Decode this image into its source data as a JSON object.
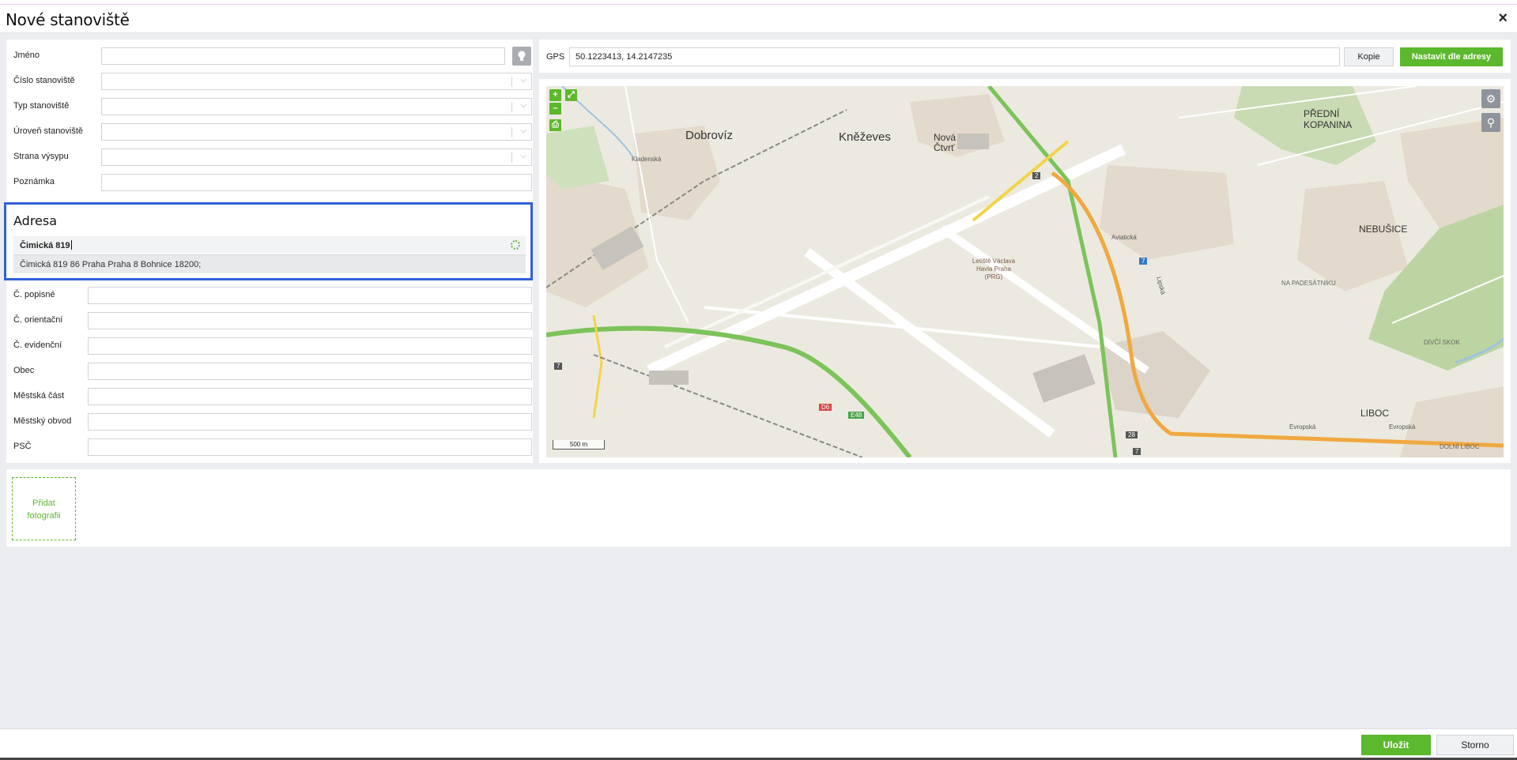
{
  "window": {
    "title": "Nové stanoviště",
    "close_icon": "×"
  },
  "form": {
    "jmeno": {
      "label": "Jméno",
      "value": ""
    },
    "cislo": {
      "label": "Číslo stanoviště",
      "value": ""
    },
    "typ": {
      "label": "Typ stanoviště",
      "value": ""
    },
    "uroven": {
      "label": "Úroveň stanoviště",
      "value": ""
    },
    "strana": {
      "label": "Strana výsypu",
      "value": ""
    },
    "poznamka": {
      "label": "Poznámka",
      "value": ""
    }
  },
  "address": {
    "heading": "Adresa",
    "search_value": "Čimická 819",
    "suggestion": "Čimická 819 86 Praha Praha 8 Bohnice 18200;",
    "fields": [
      {
        "label": "Č. popisné",
        "value": ""
      },
      {
        "label": "Č. orientační",
        "value": ""
      },
      {
        "label": "Č. evidenční",
        "value": ""
      },
      {
        "label": "Obec",
        "value": ""
      },
      {
        "label": "Městská část",
        "value": ""
      },
      {
        "label": "Městský obvod",
        "value": ""
      },
      {
        "label": "PSČ",
        "value": ""
      }
    ]
  },
  "gps": {
    "label": "GPS",
    "value": "50.1223413, 14.2147235",
    "copy_button": "Kopie",
    "set_button": "Nastavit dle adresy"
  },
  "map": {
    "zoom_in": "+",
    "zoom_out": "–",
    "labels": {
      "dobroviz": "Dobrovíz",
      "knezeves": "Kněževes",
      "nova_ctvrt": "Nová Čtvrť",
      "predni_kopanina": "PŘEDNÍ KOPANINA",
      "nebusice": "NEBUŠICE",
      "liboc": "LIBOC",
      "airport": "Letiště Václava Havla Praha (PRG)",
      "na_padesatniku": "NA PADESÁTNÍKU",
      "divci_skok": "DÍVČÍ SKOK",
      "dolni_liboc": "DOLNÍ LIBOC",
      "road_d6": "D6",
      "road_e48": "E48",
      "road_7": "7",
      "road_2": "2",
      "road_28": "28",
      "street_lipska": "Lipská",
      "street_evropska": "Evropská",
      "street_aviaticka": "Aviatická",
      "street_kladenska": "Kladenská"
    },
    "scale": "500 m"
  },
  "photos": {
    "add_label_1": "Přidat",
    "add_label_2": "fotografii"
  },
  "footer": {
    "save": "Uložit",
    "cancel": "Storno"
  },
  "colors": {
    "accent_green": "#5cb82c",
    "focus_blue": "#3060d8"
  }
}
